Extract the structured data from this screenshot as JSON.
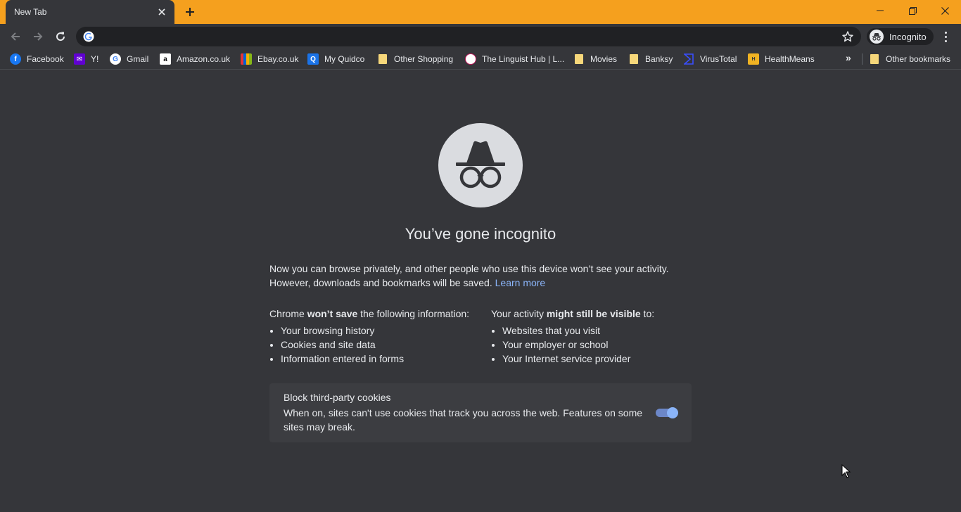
{
  "browser": {
    "tab_title": "New Tab",
    "omnibox_value": "",
    "profile_label": "Incognito"
  },
  "bookmarks": [
    {
      "label": "Facebook",
      "icon": "facebook-icon"
    },
    {
      "label": "Y!",
      "icon": "yahoo-icon"
    },
    {
      "label": "Gmail",
      "icon": "google-icon"
    },
    {
      "label": "Amazon.co.uk",
      "icon": "amazon-icon"
    },
    {
      "label": "Ebay.co.uk",
      "icon": "ebay-icon"
    },
    {
      "label": "My Quidco",
      "icon": "quidco-icon"
    },
    {
      "label": "Other Shopping",
      "icon": "folder-icon"
    },
    {
      "label": "The Linguist Hub | L...",
      "icon": "linguist-hub-icon"
    },
    {
      "label": "Movies",
      "icon": "folder-icon"
    },
    {
      "label": "Banksy",
      "icon": "folder-icon"
    },
    {
      "label": "VirusTotal",
      "icon": "virustotal-icon"
    },
    {
      "label": "HealthMeans",
      "icon": "healthmeans-icon"
    }
  ],
  "bookmarks_more": "»",
  "other_bookmarks": "Other bookmarks",
  "page": {
    "headline": "You’ve gone incognito",
    "intro_line1": "Now you can browse privately, and other people who use this device won’t see your activity.",
    "intro_line2": "However, downloads and bookmarks will be saved.",
    "learn_more": "Learn more",
    "left_head_prefix": "Chrome ",
    "left_head_bold": "won’t save",
    "left_head_suffix": " the following information:",
    "left_items": [
      "Your browsing history",
      "Cookies and site data",
      "Information entered in forms"
    ],
    "right_head_prefix": "Your activity ",
    "right_head_bold": "might still be visible",
    "right_head_suffix": " to:",
    "right_items": [
      "Websites that you visit",
      "Your employer or school",
      "Your Internet service provider"
    ],
    "cookie_title": "Block third-party cookies",
    "cookie_desc": "When on, sites can't use cookies that track you across the web. Features on some sites may break.",
    "cookie_toggle_on": true
  },
  "colors": {
    "titlebar": "#f5a01e",
    "background": "#35363a",
    "link": "#8ab4f8"
  }
}
